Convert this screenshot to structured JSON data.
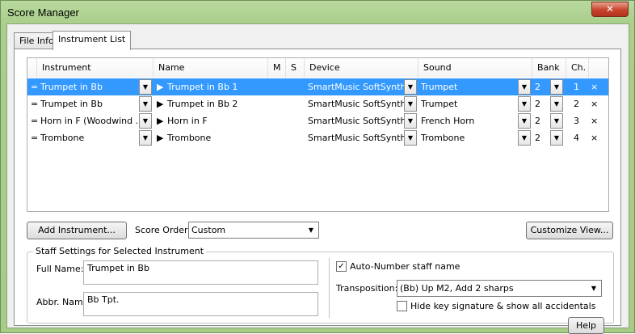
{
  "window": {
    "title": "Score Manager",
    "close_glyph": "✕"
  },
  "tabs": [
    {
      "label": "File Info"
    },
    {
      "label": "Instrument List"
    }
  ],
  "grid": {
    "columns": [
      "Instrument",
      "Name",
      "M",
      "S",
      "Device",
      "Sound",
      "Bank",
      "Ch."
    ],
    "rows": [
      {
        "drag": "=",
        "instrument": "Trumpet in Bb",
        "name": "Trumpet in Bb 1",
        "device": "SmartMusic SoftSynth",
        "sound": "Trumpet",
        "bank": "2",
        "channel": "1",
        "remove": "×"
      },
      {
        "drag": "=",
        "instrument": "Trumpet in Bb",
        "name": "Trumpet in Bb 2",
        "device": "SmartMusic SoftSynth",
        "sound": "Trumpet",
        "bank": "2",
        "channel": "2",
        "remove": "×"
      },
      {
        "drag": "=",
        "instrument": "Horn in F (Woodwind ...",
        "name": "Horn in F",
        "device": "SmartMusic SoftSynth",
        "sound": "French Horn",
        "bank": "2",
        "channel": "3",
        "remove": "×"
      },
      {
        "drag": "=",
        "instrument": "Trombone",
        "name": "Trombone",
        "device": "SmartMusic SoftSynth",
        "sound": "Trombone",
        "bank": "2",
        "channel": "4",
        "remove": "×"
      }
    ],
    "play_glyph": "▶",
    "dropdown_glyph": "▼"
  },
  "toolbar": {
    "add_instrument": "Add Instrument...",
    "score_order_label": "Score Order:",
    "score_order_value": "Custom",
    "customize_view": "Customize View..."
  },
  "staff_settings": {
    "legend": "Staff Settings for Selected Instrument",
    "full_name_label": "Full Name:",
    "full_name_value": "Trumpet in Bb",
    "abbr_name_label": "Abbr. Name:",
    "abbr_name_value": "Bb Tpt.",
    "auto_number_label": "Auto-Number staff name",
    "auto_number_checked": true,
    "check_glyph": "✓",
    "transposition_label": "Transposition:",
    "transposition_value": "(Bb) Up M2, Add 2 sharps",
    "hide_key_label": "Hide key signature & show all accidentals",
    "hide_key_checked": false,
    "help": "Help"
  }
}
